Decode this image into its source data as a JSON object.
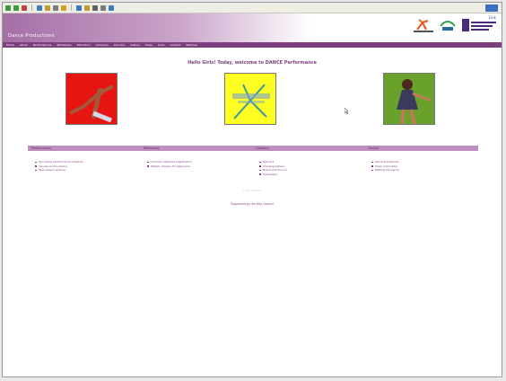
{
  "toolbar": {
    "icons": [
      "back-icon",
      "forward-icon",
      "stop-icon",
      "refresh-icon",
      "home-icon",
      "search-icon",
      "favorites-icon",
      "history-icon",
      "mail-icon",
      "print-icon",
      "edit-icon",
      "discuss-icon"
    ],
    "colors": [
      "#3a9a3a",
      "#3a9a3a",
      "#c04040",
      "#3a7ac0",
      "#c09a30",
      "#7a7a7a",
      "#d4a020",
      "#3a7ac0",
      "#c09a30",
      "#606060",
      "#7a7a7a",
      "#3a7ac0"
    ]
  },
  "banner": {
    "title": "Dance Productions",
    "corner_text": "Link",
    "accent": "#7e3f7e"
  },
  "nav": {
    "items": [
      "Home",
      "About",
      "Performances",
      "Workshops",
      "Education",
      "Company",
      "Dancers",
      "Gallery",
      "Press",
      "Links",
      "Contact",
      "Sitemap"
    ]
  },
  "main": {
    "heading": "Hello Girls! Today, welcome to DANCE Performance",
    "images": [
      {
        "name": "red-dancer-photo",
        "alt": "Performer",
        "color": "#e71512"
      },
      {
        "name": "yellow-poster",
        "alt": "Performance",
        "color": "#ffff22"
      },
      {
        "name": "green-dancer-photo",
        "alt": "Dancer",
        "color": "#6aa12a"
      }
    ]
  },
  "sections": [
    {
      "title": "Performances",
      "items": [
        "Upcoming performance schedule",
        "Venues and locations",
        "Past season archive"
      ]
    },
    {
      "title": "Workshops",
      "items": [
        "Summer intensive registration",
        "Weekly classes for beginners"
      ]
    },
    {
      "title": "Company",
      "items": [
        "Dancers",
        "Choreographers",
        "Board and donors",
        "Volunteers"
      ]
    },
    {
      "title": "Contact",
      "items": [
        "General enquiries",
        "Press and media",
        "Mailing list signup"
      ]
    }
  ],
  "footer": {
    "faint_text": "Last updated",
    "link": "Supported by the Arts Council"
  }
}
